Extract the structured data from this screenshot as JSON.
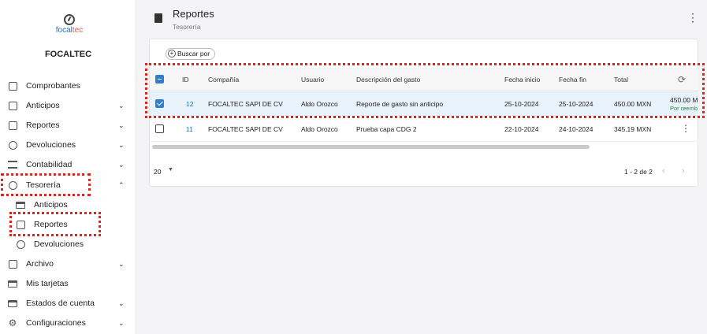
{
  "brand": {
    "logo_text_main": "focal",
    "logo_text_accent": "tec",
    "company": "FOCALTEC"
  },
  "sidebar": {
    "items": [
      {
        "label": "Comprobantes",
        "icon": "document-icon"
      },
      {
        "label": "Anticipos",
        "icon": "document-icon"
      },
      {
        "label": "Reportes",
        "icon": "document-icon"
      },
      {
        "label": "Devoluciones",
        "icon": "return-icon"
      },
      {
        "label": "Contabilidad",
        "icon": "bank-icon"
      },
      {
        "label": "Tesorería",
        "icon": "piggy-bank-icon"
      },
      {
        "label": "Anticipos",
        "icon": "cash-icon"
      },
      {
        "label": "Reportes",
        "icon": "document-icon"
      },
      {
        "label": "Devoluciones",
        "icon": "return-icon"
      },
      {
        "label": "Archivo",
        "icon": "archive-icon"
      },
      {
        "label": "Mis tarjetas",
        "icon": "card-icon"
      },
      {
        "label": "Estados de cuenta",
        "icon": "card-icon"
      },
      {
        "label": "Configuraciones",
        "icon": "gear-icon"
      }
    ]
  },
  "header": {
    "title": "Reportes",
    "subtitle": "Tesorería"
  },
  "toolbar": {
    "search_label": "Buscar por"
  },
  "table": {
    "columns": [
      "ID",
      "Compañía",
      "Usuario",
      "Descripción del gasto",
      "Fecha inicio",
      "Fecha fin",
      "Total"
    ],
    "rows": [
      {
        "id": "12",
        "company": "FOCALTEC SAPI DE CV",
        "user": "Aldo Orozco",
        "desc": "Reporte de gasto sin anticipo",
        "start": "25-10-2024",
        "end": "25-10-2024",
        "total": "450.00 MXN",
        "extra_amount": "450.00 M",
        "extra_status": "Por reemb"
      },
      {
        "id": "11",
        "company": "FOCALTEC SAPI DE CV",
        "user": "Aldo Orozco",
        "desc": "Prueba capa CDG 2",
        "start": "22-10-2024",
        "end": "24-10-2024",
        "total": "345.19 MXN"
      }
    ]
  },
  "footer": {
    "page_size": "20",
    "range": "1 - 2 de 2"
  },
  "colors": {
    "accent": "#2f7fd1",
    "highlight": "#d9251d",
    "selected_row": "#e8f2fb"
  }
}
